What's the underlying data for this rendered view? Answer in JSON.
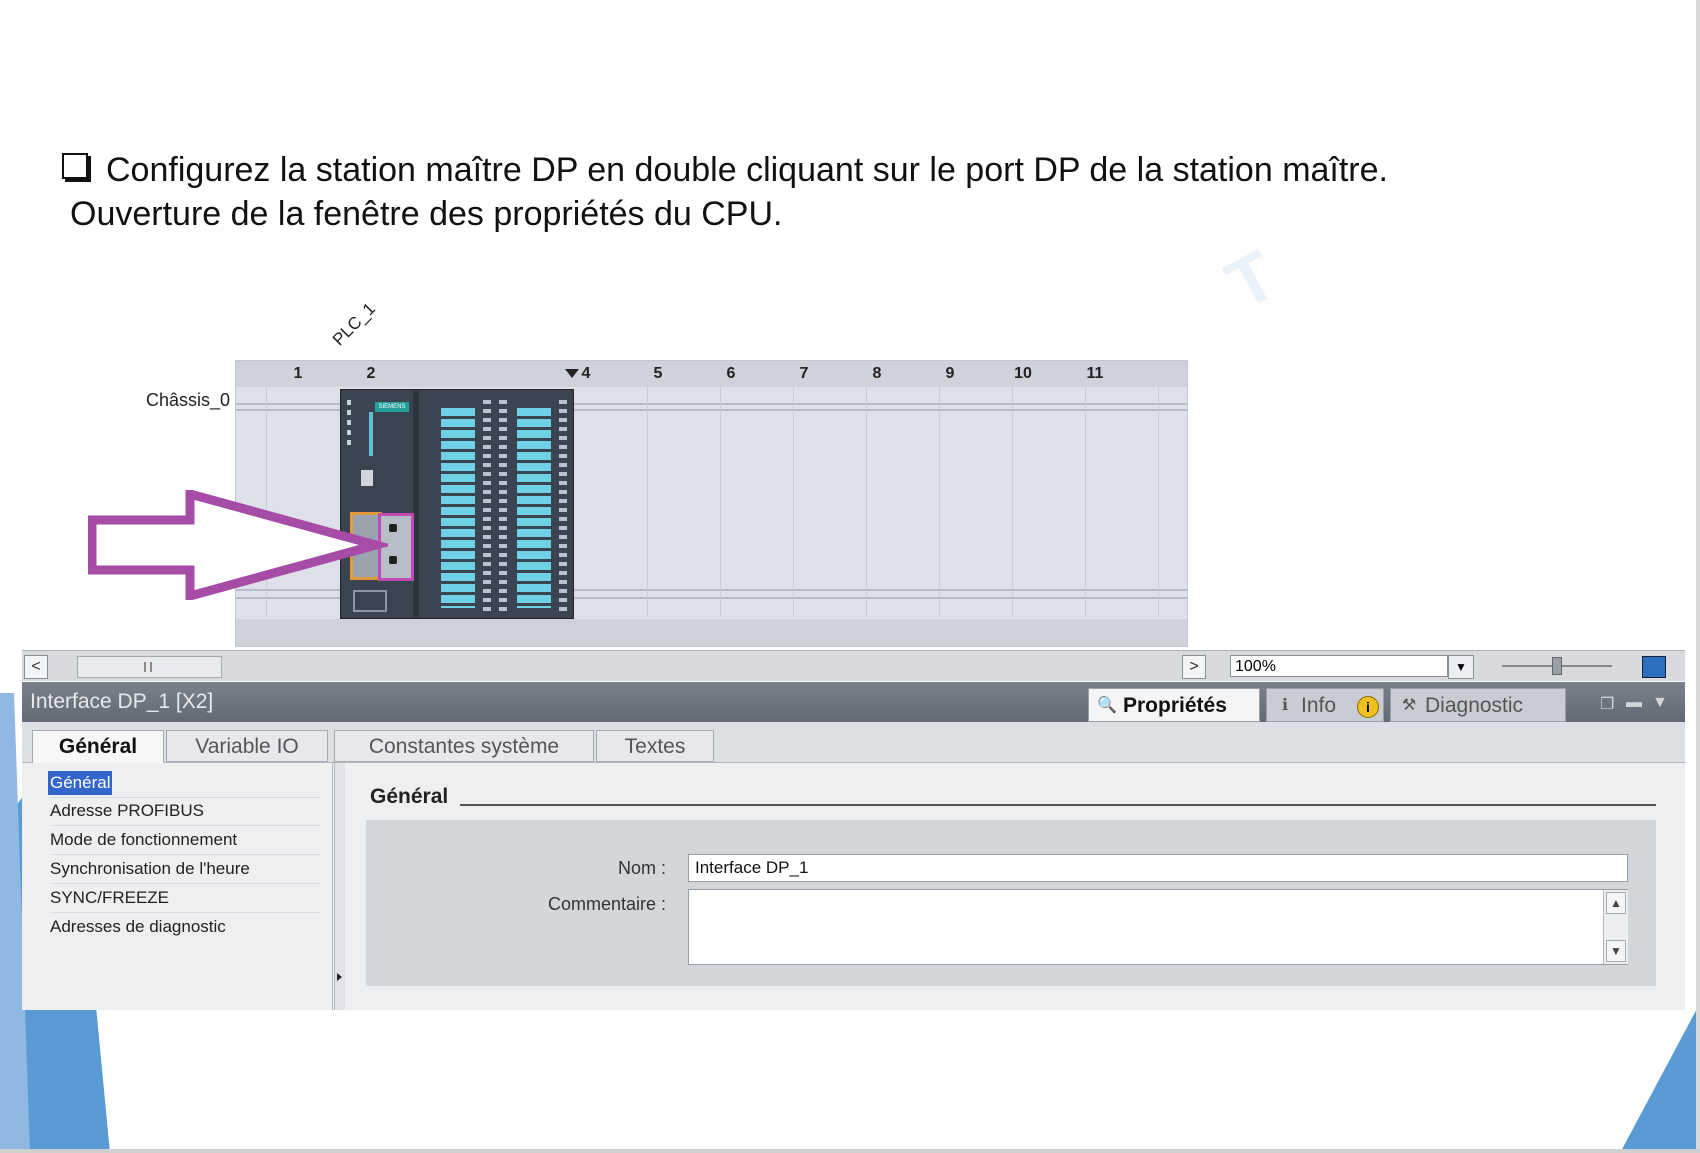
{
  "instruction": {
    "line1": "Configurez la station maître DP en double cliquant sur le port DP de la station maître.",
    "line2": "Ouverture de la fenêtre des propriétés du CPU."
  },
  "device_view": {
    "plc_label": "PLC_1",
    "chassis_label": "Châssis_0",
    "slots": [
      "1",
      "2",
      "4",
      "5",
      "6",
      "7",
      "8",
      "9",
      "10",
      "11"
    ],
    "cpu_brand": "SIEMENS"
  },
  "scroll_toolbar": {
    "left_arrow": "<",
    "right_arrow": ">",
    "zoom_value": "100%"
  },
  "properties": {
    "title": "Interface DP_1 [X2]",
    "view_tabs": {
      "properties": "Propriétés",
      "info": "Info",
      "diagnostic": "Diagnostic"
    },
    "section_tabs": [
      "Général",
      "Variable IO",
      "Constantes système",
      "Textes"
    ],
    "nav_items": [
      "Général",
      "Adresse PROFIBUS",
      "Mode de fonctionnement",
      "Synchronisation de l'heure",
      "SYNC/FREEZE",
      "Adresses de diagnostic"
    ],
    "section_title": "Général",
    "fields": {
      "name_label": "Nom :",
      "name_value": "Interface DP_1",
      "comment_label": "Commentaire :",
      "comment_value": ""
    }
  },
  "colors": {
    "arrow": "#a64ca6",
    "selection": "#3366cc",
    "deco_blue": "#5b9bd5"
  }
}
